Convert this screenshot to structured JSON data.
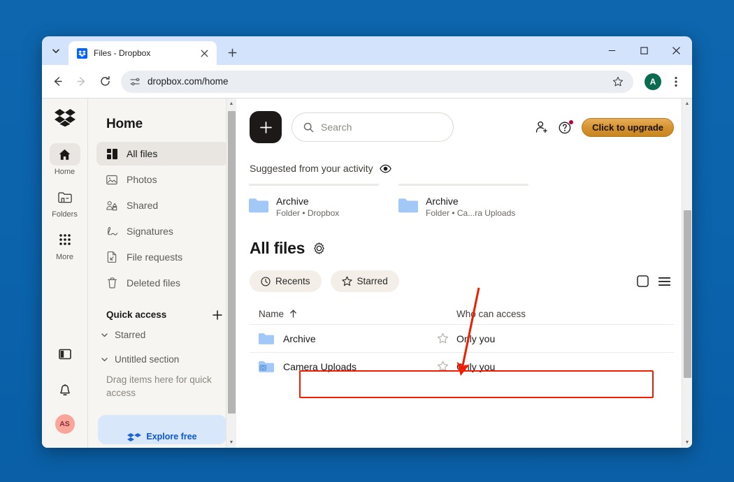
{
  "browser": {
    "tab": {
      "title": "Files - Dropbox",
      "favicon": "dropbox-icon",
      "close": "×"
    },
    "new_tab_label": "+",
    "tab_search_icon": "chevron-down-icon",
    "window_controls": {
      "minimize": "—",
      "maximize": "□",
      "close": "×"
    },
    "toolbar": {
      "back_icon": "arrow-left-icon",
      "forward_icon": "arrow-right-icon",
      "reload_icon": "reload-icon",
      "site_settings_icon": "tune-icon",
      "url": "dropbox.com/home",
      "bookmark_icon": "star-icon",
      "profile_initial": "A",
      "menu_icon": "kebab-menu-icon"
    }
  },
  "rail": {
    "logo": "dropbox-logo-icon",
    "items": [
      {
        "label": "Home",
        "icon": "home-icon",
        "active": true
      },
      {
        "label": "Folders",
        "icon": "folder-icon",
        "active": false
      },
      {
        "label": "More",
        "icon": "grid-dots-icon",
        "active": false
      }
    ],
    "bottom": [
      {
        "icon": "sidebar-panel-icon"
      },
      {
        "icon": "bell-icon"
      }
    ],
    "avatar_initials": "AS"
  },
  "sidebar": {
    "title": "Home",
    "items": [
      {
        "label": "All files",
        "icon": "all-files-icon",
        "active": true
      },
      {
        "label": "Photos",
        "icon": "photo-icon",
        "active": false
      },
      {
        "label": "Shared",
        "icon": "shared-people-icon",
        "active": false
      },
      {
        "label": "Signatures",
        "icon": "signature-icon",
        "active": false
      },
      {
        "label": "File requests",
        "icon": "file-request-icon",
        "active": false
      },
      {
        "label": "Deleted files",
        "icon": "trash-icon",
        "active": false
      }
    ],
    "quick_access": {
      "label": "Quick access",
      "add_icon": "plus-icon"
    },
    "sections": [
      {
        "label": "Starred",
        "icon": "chevron-down-icon"
      },
      {
        "label": "Untitled section",
        "icon": "chevron-down-icon"
      }
    ],
    "drag_hint": "Drag items here for quick access",
    "explore_card": {
      "label": "Explore free"
    }
  },
  "main": {
    "create_button": "+",
    "search": {
      "placeholder": "Search",
      "icon": "search-icon"
    },
    "invite_icon": "add-person-icon",
    "help_icon": "help-circle-icon",
    "upgrade_button": "Click to upgrade",
    "suggested": {
      "label": "Suggested from your activity",
      "eye_icon": "eye-icon",
      "cards": [
        {
          "name": "Archive",
          "sub": "Folder • Dropbox",
          "icon": "folder-icon"
        },
        {
          "name": "Archive",
          "sub": "Folder • Ca...ra Uploads",
          "icon": "folder-icon"
        }
      ]
    },
    "all_files": {
      "title": "All files",
      "settings_icon": "gear-icon",
      "chips": [
        {
          "label": "Recents",
          "icon": "clock-icon"
        },
        {
          "label": "Starred",
          "icon": "star-icon"
        }
      ],
      "view_toggles": [
        {
          "icon": "grid-view-icon"
        },
        {
          "icon": "list-view-icon"
        }
      ],
      "columns": {
        "name": "Name",
        "sort_icon": "arrow-up-icon",
        "access": "Who can access"
      },
      "rows": [
        {
          "name": "Archive",
          "icon": "folder-icon",
          "star_icon": "star-outline-icon",
          "access": "Only you",
          "highlighted": false
        },
        {
          "name": "Camera Uploads",
          "icon": "camera-folder-icon",
          "star_icon": "star-outline-icon",
          "access": "Only you",
          "highlighted": true
        }
      ]
    }
  },
  "annotation": {
    "arrow_color": "#f11d00",
    "box_color": "#f11d00"
  }
}
